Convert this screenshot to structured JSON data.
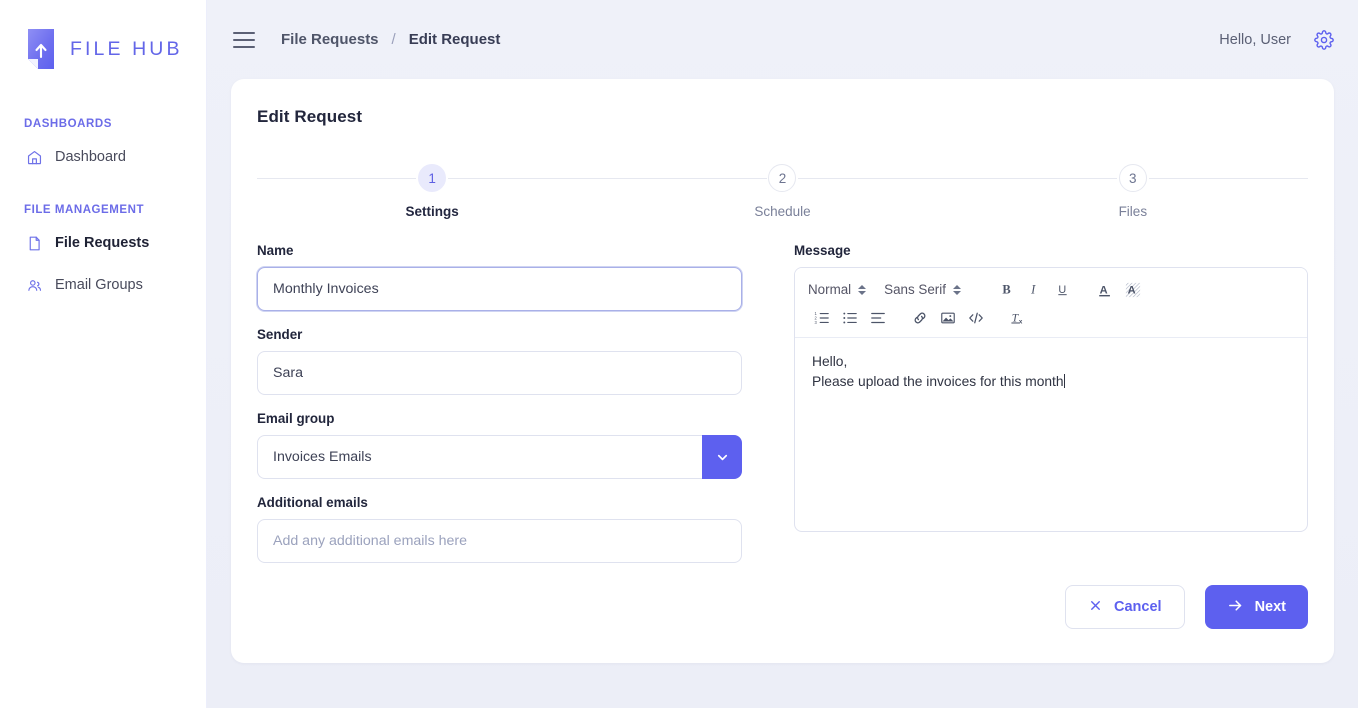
{
  "brand": {
    "name": "FILE HUB",
    "logo_icon": "file-upload-logo",
    "accent": "#5d60ef",
    "accent_light": "#e9eafc"
  },
  "sidebar": {
    "sections": [
      {
        "title": "DASHBOARDS",
        "items": [
          {
            "label": "Dashboard",
            "icon": "home-icon",
            "active": false
          }
        ]
      },
      {
        "title": "FILE MANAGEMENT",
        "items": [
          {
            "label": "File Requests",
            "icon": "document-icon",
            "active": true
          },
          {
            "label": "Email Groups",
            "icon": "users-icon",
            "active": false
          }
        ]
      }
    ]
  },
  "topbar": {
    "menu_icon": "hamburger-icon",
    "breadcrumb": {
      "parent": "File Requests",
      "separator": "/",
      "current": "Edit Request"
    },
    "greeting": "Hello, User",
    "settings_icon": "gear-icon"
  },
  "card": {
    "title": "Edit Request",
    "stepper": [
      {
        "number": "1",
        "label": "Settings",
        "active": true
      },
      {
        "number": "2",
        "label": "Schedule",
        "active": false
      },
      {
        "number": "3",
        "label": "Files",
        "active": false
      }
    ],
    "form": {
      "name": {
        "label": "Name",
        "value": "Monthly Invoices",
        "placeholder": ""
      },
      "sender": {
        "label": "Sender",
        "value": "Sara",
        "placeholder": ""
      },
      "email_group": {
        "label": "Email group",
        "value": "Invoices Emails",
        "toggle_icon": "chevron-down-icon"
      },
      "additional_emails": {
        "label": "Additional emails",
        "value": "",
        "placeholder": "Add any additional emails here"
      }
    },
    "message": {
      "label": "Message",
      "toolbar": {
        "heading_select": "Normal",
        "font_select": "Sans Serif",
        "buttons_row1": [
          {
            "name": "bold-icon",
            "glyph": "B"
          },
          {
            "name": "italic-icon",
            "glyph": "I"
          },
          {
            "name": "underline-icon",
            "glyph": "U"
          },
          {
            "name": "text-color-icon",
            "glyph": "A"
          },
          {
            "name": "highlight-color-icon",
            "glyph": "A"
          }
        ],
        "buttons_row2": [
          {
            "name": "ordered-list-icon"
          },
          {
            "name": "bullet-list-icon"
          },
          {
            "name": "align-left-icon"
          },
          {
            "name": "link-icon"
          },
          {
            "name": "image-icon"
          },
          {
            "name": "code-block-icon"
          },
          {
            "name": "clear-formatting-icon"
          }
        ]
      },
      "body_lines": [
        "Hello,",
        "Please upload the invoices for this month"
      ]
    },
    "actions": {
      "cancel": {
        "label": "Cancel",
        "icon": "close-x-icon"
      },
      "next": {
        "label": "Next",
        "icon": "arrow-right-icon"
      }
    }
  }
}
